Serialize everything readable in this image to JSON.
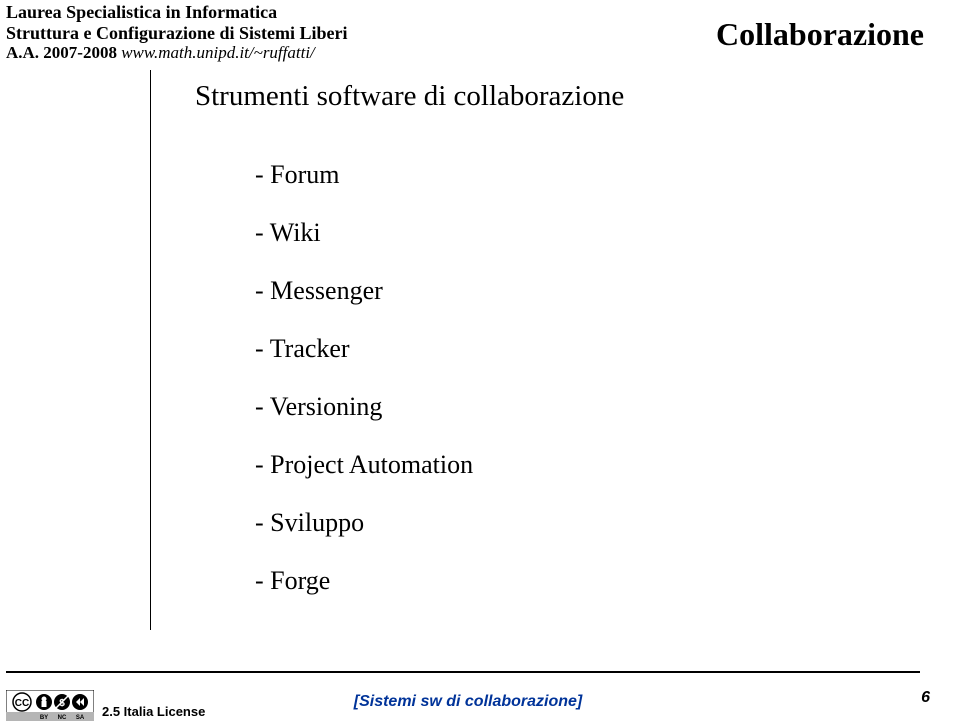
{
  "header": {
    "line1": "Laurea Specialistica in Informatica",
    "line2": "Struttura e Configurazione di Sistemi Liberi",
    "line3_bold": "A.A. 2007-2008",
    "line3_italic": " www.math.unipd.it/~ruffatti/",
    "title_right": "Collaborazione"
  },
  "subtitle": "Strumenti software di collaborazione",
  "list": {
    "items": [
      "- Forum",
      "- Wiki",
      "- Messenger",
      "- Tracker",
      "- Versioning",
      "- Project Automation",
      "- Sviluppo",
      "- Forge"
    ]
  },
  "footer": {
    "license_text": "2.5 Italia License",
    "center": "[Sistemi sw di collaborazione]",
    "page": "6"
  }
}
